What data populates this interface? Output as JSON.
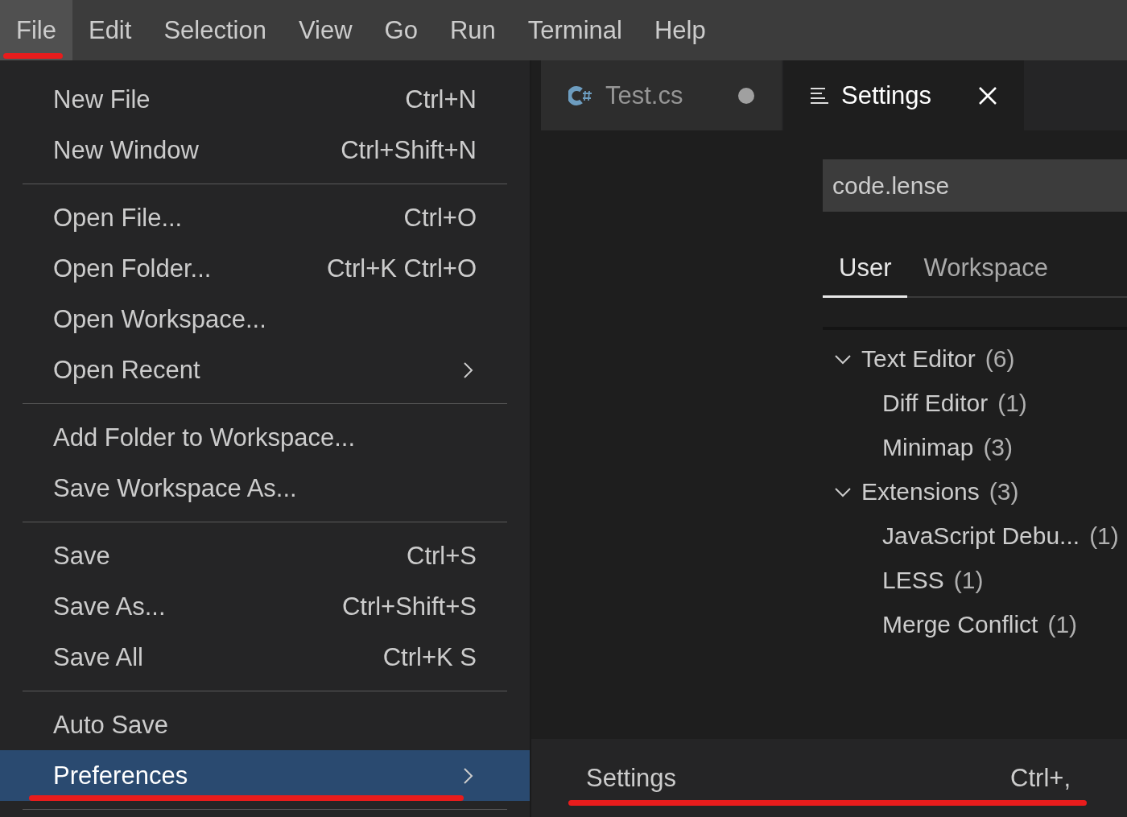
{
  "menubar": [
    {
      "label": "File",
      "selected": true,
      "underlined": true
    },
    {
      "label": "Edit",
      "selected": false,
      "underlined": false
    },
    {
      "label": "Selection",
      "selected": false,
      "underlined": false
    },
    {
      "label": "View",
      "selected": false,
      "underlined": false
    },
    {
      "label": "Go",
      "selected": false,
      "underlined": false
    },
    {
      "label": "Run",
      "selected": false,
      "underlined": false
    },
    {
      "label": "Terminal",
      "selected": false,
      "underlined": false
    },
    {
      "label": "Help",
      "selected": false,
      "underlined": false
    }
  ],
  "file_menu": [
    [
      {
        "label": "New File",
        "shortcut": "Ctrl+N",
        "has_submenu": false,
        "selected": false,
        "underlined": false
      },
      {
        "label": "New Window",
        "shortcut": "Ctrl+Shift+N",
        "has_submenu": false,
        "selected": false,
        "underlined": false
      }
    ],
    [
      {
        "label": "Open File...",
        "shortcut": "Ctrl+O",
        "has_submenu": false,
        "selected": false,
        "underlined": false
      },
      {
        "label": "Open Folder...",
        "shortcut": "Ctrl+K Ctrl+O",
        "has_submenu": false,
        "selected": false,
        "underlined": false
      },
      {
        "label": "Open Workspace...",
        "has_submenu": false,
        "selected": false,
        "underlined": false
      },
      {
        "label": "Open Recent",
        "has_submenu": true,
        "selected": false,
        "underlined": false
      }
    ],
    [
      {
        "label": "Add Folder to Workspace...",
        "has_submenu": false,
        "selected": false,
        "underlined": false
      },
      {
        "label": "Save Workspace As...",
        "has_submenu": false,
        "selected": false,
        "underlined": false
      }
    ],
    [
      {
        "label": "Save",
        "shortcut": "Ctrl+S",
        "has_submenu": false,
        "selected": false,
        "underlined": false
      },
      {
        "label": "Save As...",
        "shortcut": "Ctrl+Shift+S",
        "has_submenu": false,
        "selected": false,
        "underlined": false
      },
      {
        "label": "Save All",
        "shortcut": "Ctrl+K S",
        "has_submenu": false,
        "selected": false,
        "underlined": false
      }
    ],
    [
      {
        "label": "Auto Save",
        "has_submenu": false,
        "selected": false,
        "underlined": false
      },
      {
        "label": "Preferences",
        "has_submenu": true,
        "selected": true,
        "underlined": true
      }
    ]
  ],
  "editor_tabs": [
    {
      "label": "Test.cs",
      "kind": "csharp",
      "selected": false,
      "dirty": true
    },
    {
      "label": "Settings",
      "kind": "settings",
      "selected": true,
      "dirty": false
    }
  ],
  "settings": {
    "search": {
      "value": "code.lense"
    },
    "scope_tabs": [
      {
        "label": "User",
        "selected": true
      },
      {
        "label": "Workspace",
        "selected": false
      }
    ],
    "tree": [
      {
        "label": "Text Editor",
        "count": "(6)",
        "expanded": true,
        "children": [
          {
            "label": "Diff Editor",
            "count": "(1)"
          },
          {
            "label": "Minimap",
            "count": "(3)"
          }
        ]
      },
      {
        "label": "Extensions",
        "count": "(3)",
        "expanded": true,
        "children": [
          {
            "label": "JavaScript Debu...",
            "count": "(1)"
          },
          {
            "label": "LESS",
            "count": "(1)"
          },
          {
            "label": "Merge Conflict",
            "count": "(1)"
          }
        ]
      }
    ]
  },
  "preferences_submenu": [
    {
      "label": "Settings",
      "shortcut": "Ctrl+,",
      "underlined": true
    }
  ]
}
